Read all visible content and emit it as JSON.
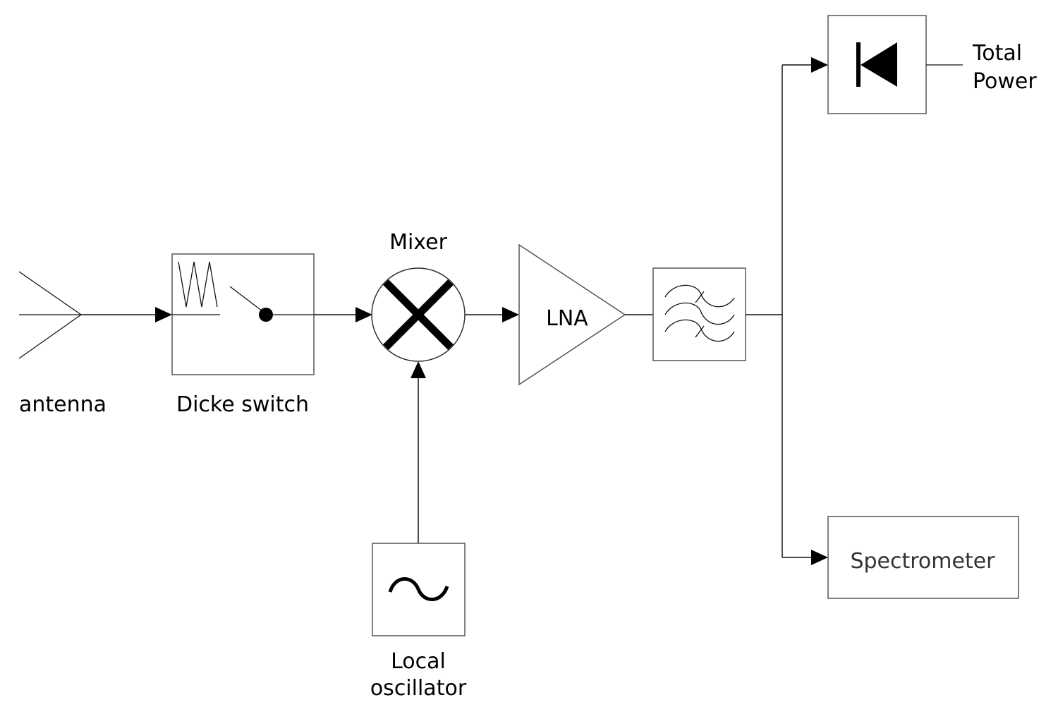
{
  "diagram": {
    "type": "block-diagram",
    "subject": "Radiometer receiver chain",
    "blocks": [
      {
        "id": "antenna",
        "label": "antenna",
        "icon": "antenna-icon"
      },
      {
        "id": "dicke_switch",
        "label": "Dicke switch",
        "icon": "switch-with-load-icon"
      },
      {
        "id": "mixer",
        "label": "Mixer",
        "icon": "mixer-cross-icon"
      },
      {
        "id": "local_oscillator",
        "label_lines": [
          "Local",
          "oscillator"
        ],
        "icon": "sine-wave-icon"
      },
      {
        "id": "lna",
        "label": "LNA",
        "icon": "amplifier-triangle-icon"
      },
      {
        "id": "bandpass_filter",
        "label": "",
        "icon": "bandpass-filter-icon"
      },
      {
        "id": "total_power",
        "label_lines": [
          "Total",
          "Power"
        ],
        "icon": "diode-detector-icon"
      },
      {
        "id": "spectrometer",
        "label": "Spectrometer",
        "icon": ""
      }
    ],
    "connections": [
      {
        "from": "antenna",
        "to": "dicke_switch",
        "arrow": true
      },
      {
        "from": "dicke_switch",
        "to": "mixer",
        "arrow": true
      },
      {
        "from": "local_oscillator",
        "to": "mixer",
        "arrow": true
      },
      {
        "from": "mixer",
        "to": "lna",
        "arrow": true
      },
      {
        "from": "lna",
        "to": "bandpass_filter",
        "arrow": false
      },
      {
        "from": "bandpass_filter",
        "to": "total_power",
        "arrow": true
      },
      {
        "from": "bandpass_filter",
        "to": "spectrometer",
        "arrow": true
      }
    ]
  },
  "labels": {
    "antenna": "antenna",
    "dicke_switch": "Dicke switch",
    "mixer": "Mixer",
    "lna": "LNA",
    "local_oscillator_line1": "Local",
    "local_oscillator_line2": "oscillator",
    "total_power_line1": "Total",
    "total_power_line2": "Power",
    "spectrometer": "Spectrometer"
  }
}
